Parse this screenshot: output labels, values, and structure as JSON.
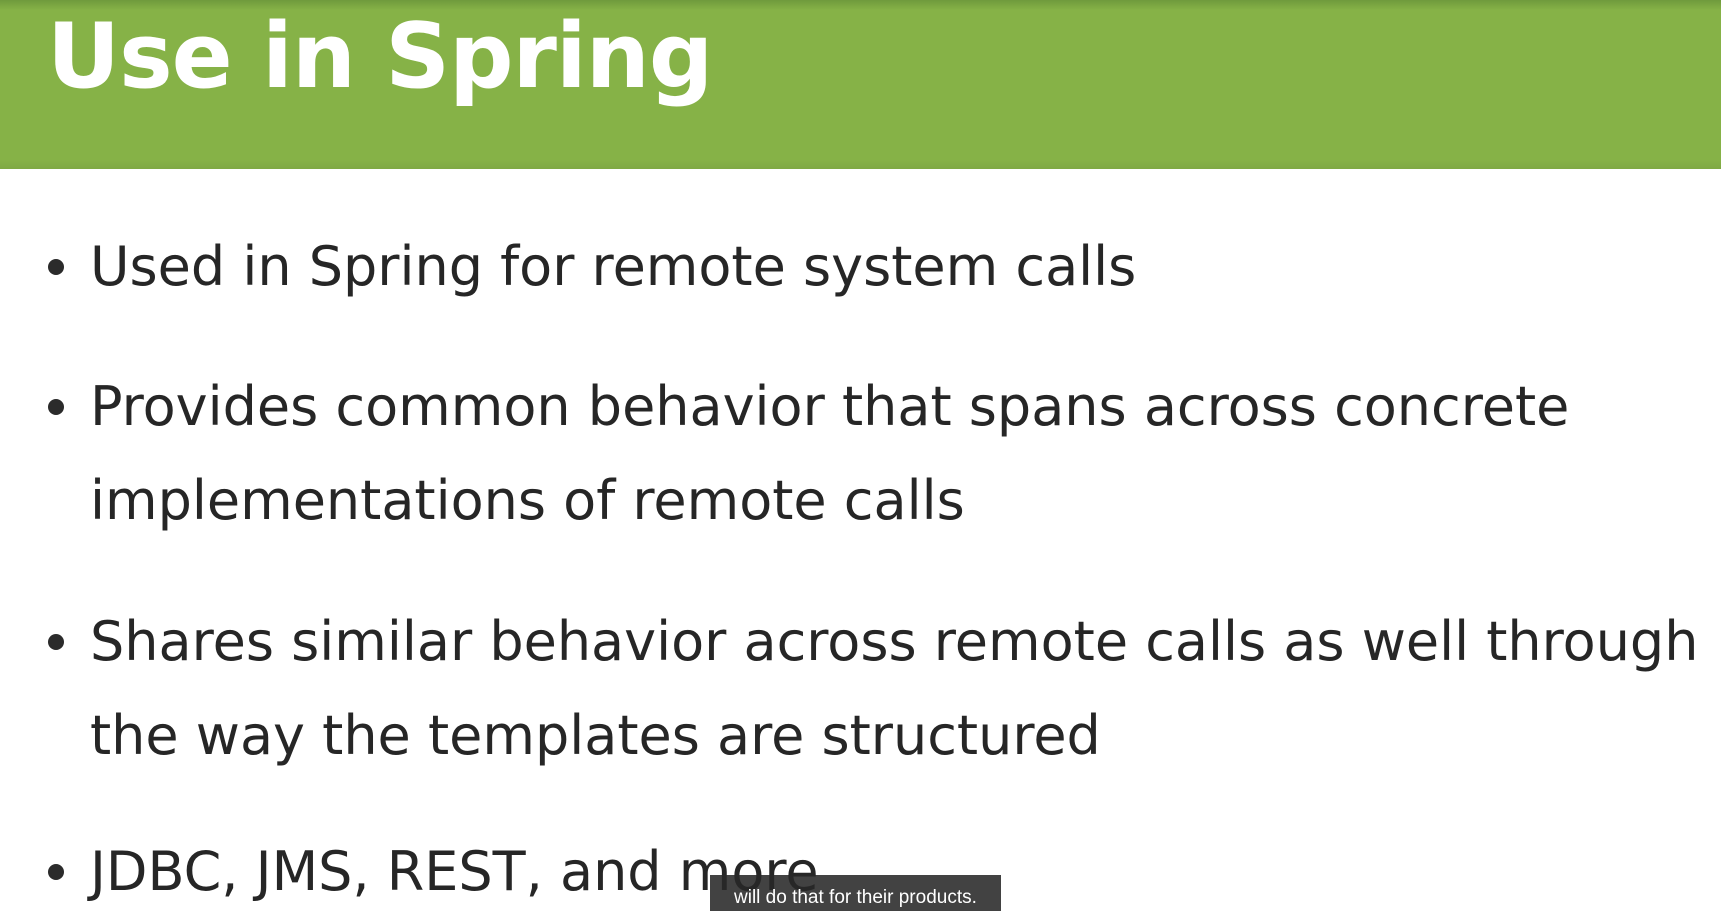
{
  "slide": {
    "title": "Use in Spring",
    "bullets": [
      {
        "lines": [
          "Used in Spring for remote system calls"
        ]
      },
      {
        "lines": [
          "Provides common behavior that spans across concrete",
          "implementations of remote calls"
        ]
      },
      {
        "lines": [
          "Shares similar behavior across remote calls as well through",
          "the way the templates are structured"
        ]
      },
      {
        "lines": [
          "JDBC, JMS, REST, and more"
        ]
      }
    ]
  },
  "caption": {
    "text": "will do that for their products."
  },
  "colors": {
    "header": "#86b247",
    "title_text": "#ffffff",
    "body_text": "#262626",
    "caption_bg": "#282828"
  }
}
